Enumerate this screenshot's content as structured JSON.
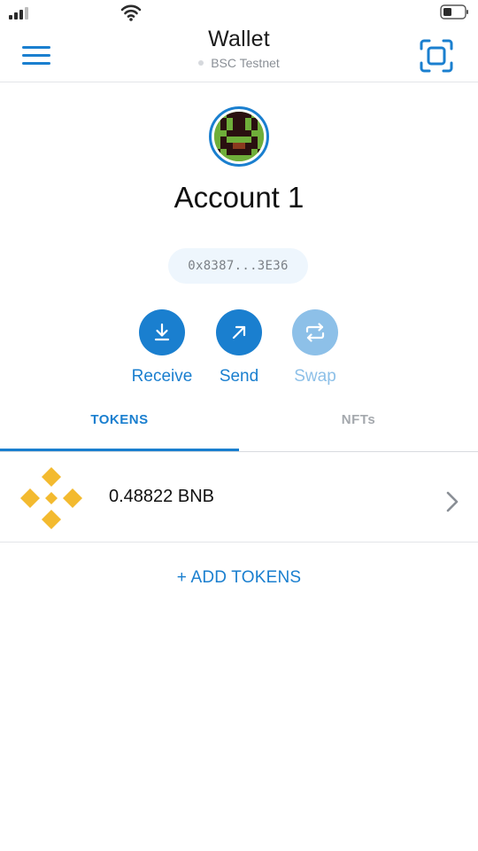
{
  "header": {
    "title": "Wallet",
    "network": "BSC Testnet"
  },
  "account": {
    "name": "Account 1",
    "address": "0x8387...3E36"
  },
  "actions": [
    {
      "label": "Receive",
      "icon": "download-icon",
      "enabled": true
    },
    {
      "label": "Send",
      "icon": "send-arrow-icon",
      "enabled": true
    },
    {
      "label": "Swap",
      "icon": "swap-icon",
      "enabled": false
    }
  ],
  "tabs": [
    {
      "label": "TOKENS",
      "active": true
    },
    {
      "label": "NFTs",
      "active": false
    }
  ],
  "tokens": [
    {
      "balance": "0.48822 BNB",
      "icon": "bnb-logo"
    }
  ],
  "add_tokens_label": "+ ADD TOKENS",
  "colors": {
    "accent": "#1a7fcf",
    "accent_disabled": "#8dc0e8",
    "bnb": "#f3ba2f"
  }
}
